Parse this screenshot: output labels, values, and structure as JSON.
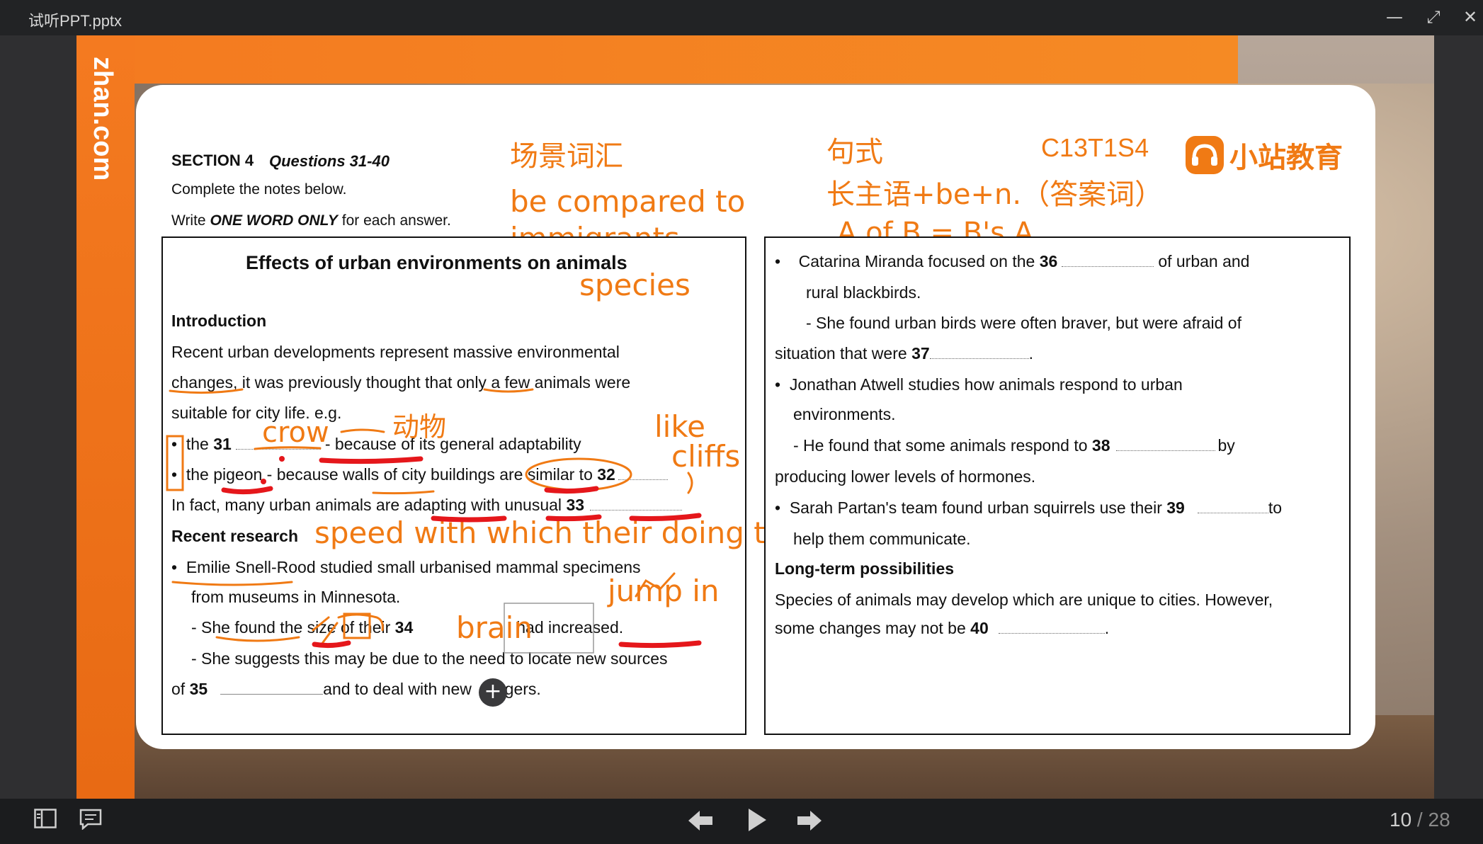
{
  "window": {
    "title": "试听PPT.pptx",
    "minimize": "—",
    "restore": "⤢",
    "close": "✕"
  },
  "brand": {
    "side_logo": "zhan.com",
    "name": "小站教育"
  },
  "header": {
    "section": "SECTION 4",
    "questions": "Questions  31-40",
    "instruction1": "Complete the notes below.",
    "instruction2_pre": "Write ",
    "instruction2_em": "ONE WORD ONLY",
    "instruction2_post": " for each answer."
  },
  "annotations_top": {
    "scene_vocab": "场景词汇",
    "compared": "be compared to",
    "immigrants": "immigrants",
    "sentence_pattern": "句式",
    "code": "C13T1S4",
    "long_subject": "长主语+be+n.（答案词）",
    "aofb": "A of B = B's A"
  },
  "left_box": {
    "title": "Effects of urban environments on animals",
    "intro_heading": "Introduction",
    "intro_l1": "Recent urban developments represent massive environmental",
    "intro_l2": "changes, it was previously thought that only a few animals were",
    "intro_l3": "suitable for city life. e.g.",
    "b1_pre": "the ",
    "b1_num": "31",
    "b1_post": "- because of its general adaptability",
    "b2_pre": "the pigeon - because walls of city buildings are similar to ",
    "b2_num": "32",
    "fact_pre": "In fact, many urban animals are adapting with unusual ",
    "fact_num": "33",
    "research_heading": "Recent research",
    "r1": "Emilie Snell-Rood studied small urbanised mammal specimens",
    "r2": "from museums in Minnesota.",
    "r3_pre": "- She found the size of their ",
    "r3_num": "34",
    "r3_post": "had increased.",
    "r4": "- She suggests this may be due to the need to locate new sources",
    "r5_pre": "of ",
    "r5_num": "35",
    "r5_mid": "and to deal with new",
    "r5_post": "ngers."
  },
  "left_annotations": {
    "species": "species",
    "animal": "动物",
    "crow": "crow",
    "like": "like",
    "cliffs": "cliffs",
    "speed": "speed with which their doing this",
    "jump": "jump in",
    "brain": "brain"
  },
  "right_box": {
    "p1_pre": "Catarina Miranda focused on the ",
    "p1_num": "36",
    "p1_post": "of urban and",
    "p1_l2": "rural blackbirds.",
    "p2_l1": "- She found urban birds were often braver, but were afraid of",
    "p2_l2_pre": "situation that were ",
    "p2_num": "37",
    "p3_l1": "Jonathan Atwell studies how animals respond to urban",
    "p3_l2": "environments.",
    "p4_pre": "- He found that some animals respond to ",
    "p4_num": "38",
    "p4_post": "by",
    "p4_l2": "producing lower levels of hormones.",
    "p5_pre": "Sarah Partan's team found urban squirrels use their ",
    "p5_num": "39",
    "p5_post": "to",
    "p5_l2": "help them communicate.",
    "lt_heading": "Long-term possibilities",
    "lt_l1": "Species of animals may develop which are unique to cities. However,",
    "lt_l2_pre": "some changes may not be ",
    "lt_num": "40"
  },
  "controls": {
    "page_current": "10",
    "page_sep": " / ",
    "page_total": "28",
    "bullet": "•",
    "plus": "+",
    "period": "."
  },
  "colors": {
    "accent": "#f07a14",
    "ink_red": "#e5171b",
    "slide_orange": "#f47a20"
  }
}
